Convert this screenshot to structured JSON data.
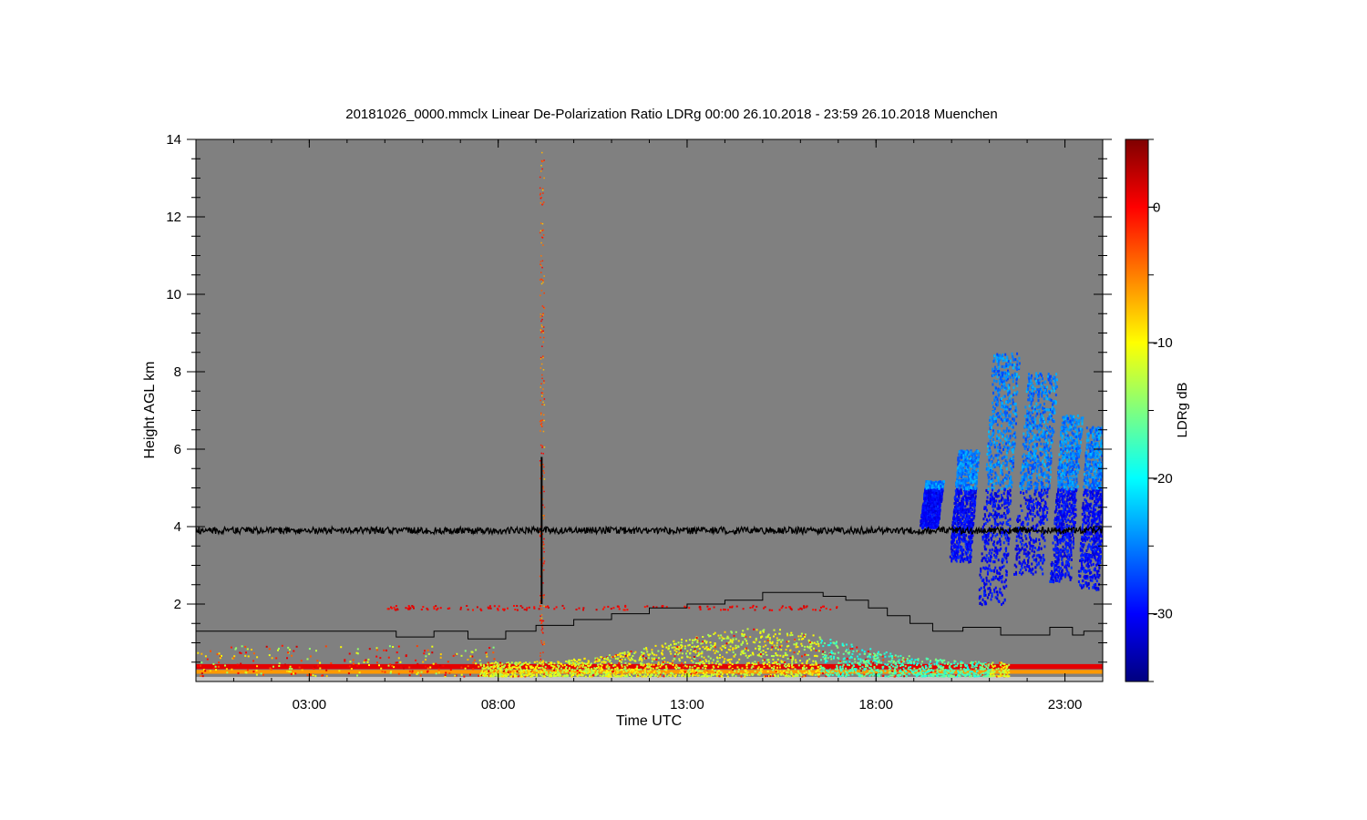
{
  "chart_data": {
    "type": "heatmap",
    "title": "20181026_0000.mmclx Linear De-Polarization Ratio LDRg   00:00 26.10.2018 - 23:59 26.10.2018 Muenchen",
    "xlabel": "Time UTC",
    "ylabel": "Height AGL km",
    "x_unit": "hours UTC",
    "xlim": [
      0,
      24
    ],
    "ylim": [
      0,
      14
    ],
    "x_ticks": [
      {
        "value": 3,
        "label": "03:00"
      },
      {
        "value": 8,
        "label": "08:00"
      },
      {
        "value": 13,
        "label": "13:00"
      },
      {
        "value": 18,
        "label": "18:00"
      },
      {
        "value": 23,
        "label": "23:00"
      }
    ],
    "y_ticks": [
      {
        "value": 2,
        "label": "2"
      },
      {
        "value": 4,
        "label": "4"
      },
      {
        "value": 6,
        "label": "6"
      },
      {
        "value": 8,
        "label": "8"
      },
      {
        "value": 10,
        "label": "10"
      },
      {
        "value": 12,
        "label": "12"
      },
      {
        "value": 14,
        "label": "14"
      }
    ],
    "background_color": "#808080",
    "colorbar": {
      "label": "LDRg dB",
      "range": [
        -35,
        5
      ],
      "ticks": [
        {
          "value": 0,
          "label": "0"
        },
        {
          "value": -10,
          "label": "-10"
        },
        {
          "value": -20,
          "label": "-20"
        },
        {
          "value": -30,
          "label": "-30"
        }
      ],
      "colormap": [
        "#00007f",
        "#0000ff",
        "#007fff",
        "#00ffff",
        "#7fff7f",
        "#ffff00",
        "#ff7f00",
        "#ff0000",
        "#7f0000"
      ]
    },
    "reference_line": {
      "name": "black trace",
      "values": [
        {
          "x": 0,
          "y": 3.9
        },
        {
          "x": 24,
          "y": 3.9
        }
      ]
    },
    "step_line": {
      "values": [
        [
          0,
          1.3
        ],
        [
          5.3,
          1.15
        ],
        [
          6.3,
          1.3
        ],
        [
          7.2,
          1.1
        ],
        [
          8.2,
          1.3
        ],
        [
          9.0,
          1.45
        ],
        [
          10.0,
          1.6
        ],
        [
          11.0,
          1.75
        ],
        [
          12.0,
          1.9
        ],
        [
          13.0,
          2.0
        ],
        [
          14.0,
          2.1
        ],
        [
          15.0,
          2.3
        ],
        [
          16.6,
          2.2
        ],
        [
          17.2,
          2.1
        ],
        [
          17.8,
          1.9
        ],
        [
          18.3,
          1.7
        ],
        [
          18.9,
          1.5
        ],
        [
          19.5,
          1.3
        ],
        [
          20.3,
          1.4
        ],
        [
          21.3,
          1.2
        ],
        [
          22.6,
          1.4
        ],
        [
          23.2,
          1.2
        ],
        [
          23.5,
          1.3
        ],
        [
          24.0,
          1.3
        ]
      ]
    },
    "features": [
      {
        "name": "boundary layer aerosol",
        "x_range": [
          8.0,
          21.0
        ],
        "y_range": [
          0.1,
          1.4
        ],
        "ldr_db": -12
      },
      {
        "name": "cirrus / ice cloud",
        "x_range": [
          19.0,
          24.0
        ],
        "y_range": [
          2.0,
          8.5
        ],
        "ldr_db": -27
      },
      {
        "name": "surface clutter layer",
        "x_range": [
          0,
          24
        ],
        "y_range": [
          0.2,
          0.45
        ],
        "ldr_db": 0
      }
    ]
  }
}
